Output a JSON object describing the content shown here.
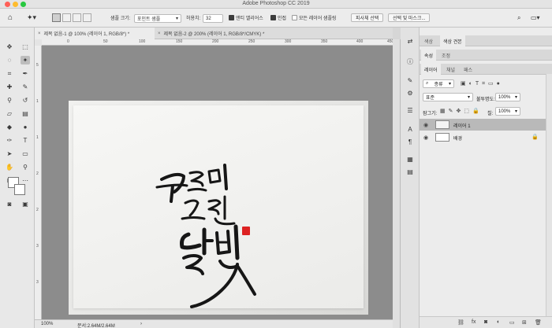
{
  "app": {
    "title": "Adobe Photoshop CC 2019"
  },
  "options_bar": {
    "sample_size_label": "샘플 크기:",
    "sample_size_value": "포인트 샘플",
    "tolerance_label": "허용치:",
    "tolerance_value": "32",
    "antialias_label": "앤티 앨리어스",
    "contiguous_label": "인접",
    "all_layers_label": "모든 레이어 샘플링",
    "subject_button": "피사체 선택",
    "select_mask_button": "선택 및 마스크..."
  },
  "tabs": [
    {
      "label": "제목 없음-1 @ 100% (레이어 1, RGB/8*) *",
      "active": true
    },
    {
      "label": "제목 없음-2 @ 200% (레이어 1, RGB/8*/CMYK) *",
      "active": false
    }
  ],
  "rulers": {
    "h_labels": [
      "0",
      "50",
      "100",
      "150",
      "200",
      "250",
      "300",
      "350",
      "400",
      "450"
    ],
    "v_labels": [
      "5",
      "1",
      "1",
      "2",
      "2",
      "3",
      "3"
    ]
  },
  "canvas": {
    "artwork": "구름이 그린 달빛"
  },
  "status": {
    "zoom": "100%",
    "doc_size": "문서:2.64M/2.64M"
  },
  "panels": {
    "top_tabs": [
      "색상",
      "색상 견본"
    ],
    "mid_tabs": [
      "속성",
      "조정"
    ],
    "layer_tabs": [
      "레이어",
      "채널",
      "패스"
    ],
    "filter_kind": "종류",
    "blend_mode": "표준",
    "opacity_label": "불투명도:",
    "opacity_value": "100%",
    "lock_label": "잠그기:",
    "fill_label": "칠:",
    "fill_value": "100%",
    "layers": [
      {
        "name": "레이어 1",
        "selected": true
      },
      {
        "name": "배경",
        "selected": false
      }
    ]
  }
}
